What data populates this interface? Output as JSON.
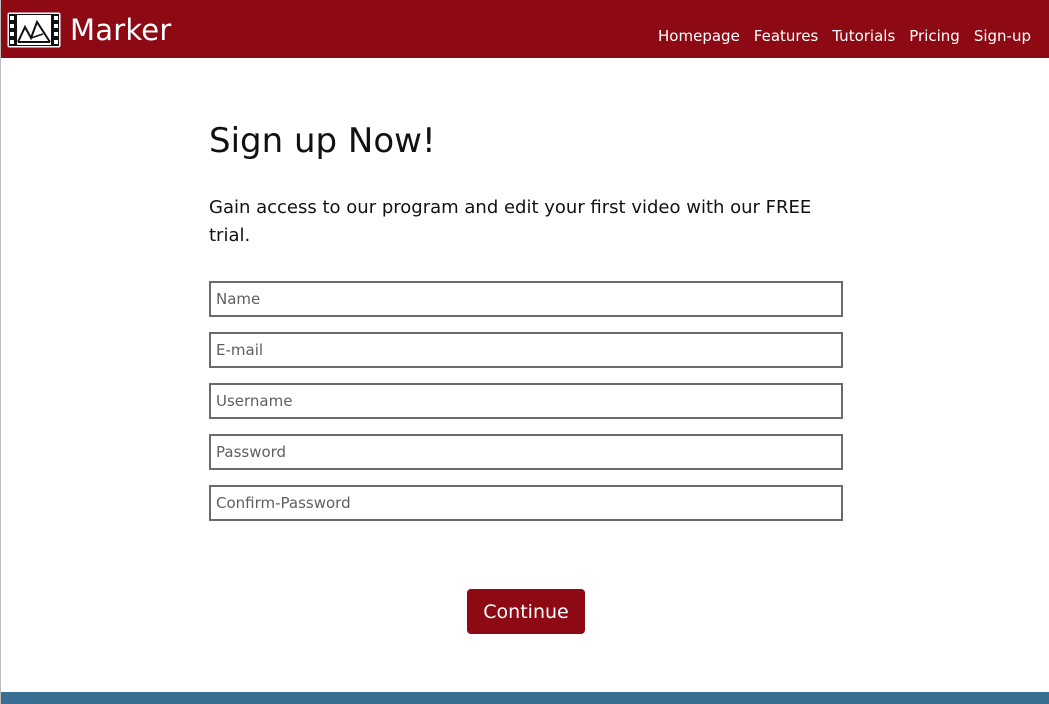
{
  "brand": {
    "name": "Marker",
    "logo_icon": "film-strip-mountain-icon"
  },
  "nav": {
    "items": [
      {
        "label": "Homepage"
      },
      {
        "label": "Features"
      },
      {
        "label": "Tutorials"
      },
      {
        "label": "Pricing"
      },
      {
        "label": "Sign-up"
      }
    ]
  },
  "main": {
    "title": "Sign up Now!",
    "subtitle": "Gain access to our program and edit your first video with our FREE trial."
  },
  "form": {
    "name": {
      "placeholder": "Name",
      "value": ""
    },
    "email": {
      "placeholder": "E-mail",
      "value": ""
    },
    "username": {
      "placeholder": "Username",
      "value": ""
    },
    "password": {
      "placeholder": "Password",
      "value": ""
    },
    "confirm_password": {
      "placeholder": "Confirm-Password",
      "value": ""
    },
    "submit_label": "Continue"
  },
  "colors": {
    "brand_red": "#8d0a14",
    "footer_blue": "#3b6f92",
    "input_border": "#6b6b6b"
  }
}
